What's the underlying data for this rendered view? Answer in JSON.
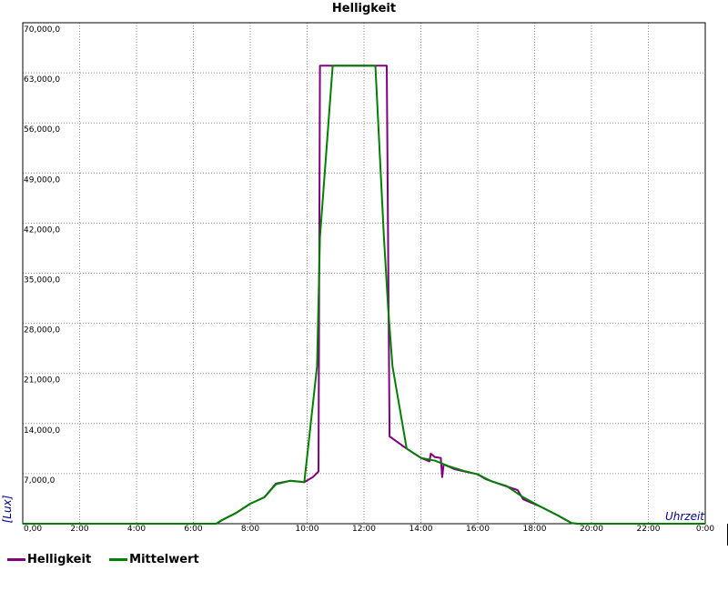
{
  "chart_data": {
    "type": "line",
    "title": "Helligkeit",
    "xlabel": "Uhrzeit",
    "ylabel": "[Lux]",
    "xlim": [
      0,
      24
    ],
    "ylim": [
      0,
      70000
    ],
    "x_ticks": [
      "0,00",
      "2:00",
      "4:00",
      "6:00",
      "8:00",
      "10:00",
      "12:00",
      "14:00",
      "16:00",
      "18:00",
      "20:00",
      "22:00",
      "0:00"
    ],
    "y_ticks": [
      "7,000,0",
      "14,000,0",
      "21,000,0",
      "28,000,0",
      "35,000,0",
      "42,000,0",
      "49,000,0",
      "56,000,0",
      "63,000,0",
      "70,000,0"
    ],
    "grid": true,
    "legend_position": "bottom-left",
    "series": [
      {
        "name": "Helligkeit",
        "color": "#800080",
        "points": [
          [
            0,
            0
          ],
          [
            6.8,
            0
          ],
          [
            7.0,
            500
          ],
          [
            7.5,
            1500
          ],
          [
            8.0,
            2800
          ],
          [
            8.5,
            3700
          ],
          [
            8.9,
            5600
          ],
          [
            9.4,
            6000
          ],
          [
            9.9,
            5800
          ],
          [
            10.2,
            6500
          ],
          [
            10.4,
            7300
          ],
          [
            10.45,
            64000
          ],
          [
            12.8,
            64000
          ],
          [
            12.9,
            12200
          ],
          [
            13.5,
            10500
          ],
          [
            14.0,
            9200
          ],
          [
            14.3,
            8700
          ],
          [
            14.35,
            9800
          ],
          [
            14.5,
            9300
          ],
          [
            14.7,
            9200
          ],
          [
            14.75,
            6500
          ],
          [
            14.8,
            8300
          ],
          [
            15.2,
            7600
          ],
          [
            16.0,
            6900
          ],
          [
            16.3,
            6200
          ],
          [
            16.8,
            5500
          ],
          [
            17.4,
            4700
          ],
          [
            17.6,
            3400
          ],
          [
            18.2,
            2400
          ],
          [
            18.8,
            1200
          ],
          [
            19.3,
            100
          ],
          [
            19.5,
            0
          ],
          [
            24,
            0
          ]
        ]
      },
      {
        "name": "Mittelwert",
        "color": "#008000",
        "points": [
          [
            0,
            0
          ],
          [
            6.8,
            0
          ],
          [
            7.0,
            500
          ],
          [
            7.5,
            1500
          ],
          [
            8.0,
            2800
          ],
          [
            8.5,
            3700
          ],
          [
            8.9,
            5500
          ],
          [
            9.4,
            6000
          ],
          [
            9.9,
            5800
          ],
          [
            10.35,
            22000
          ],
          [
            10.45,
            40000
          ],
          [
            10.9,
            64000
          ],
          [
            12.4,
            64000
          ],
          [
            12.7,
            40000
          ],
          [
            12.85,
            30000
          ],
          [
            13.0,
            22000
          ],
          [
            13.5,
            10500
          ],
          [
            14.0,
            9200
          ],
          [
            14.5,
            8800
          ],
          [
            15.0,
            8000
          ],
          [
            15.5,
            7400
          ],
          [
            16.0,
            6900
          ],
          [
            16.5,
            5900
          ],
          [
            17.0,
            5300
          ],
          [
            17.6,
            3700
          ],
          [
            18.2,
            2400
          ],
          [
            18.8,
            1200
          ],
          [
            19.3,
            100
          ],
          [
            19.5,
            0
          ],
          [
            24,
            0
          ]
        ]
      }
    ]
  }
}
